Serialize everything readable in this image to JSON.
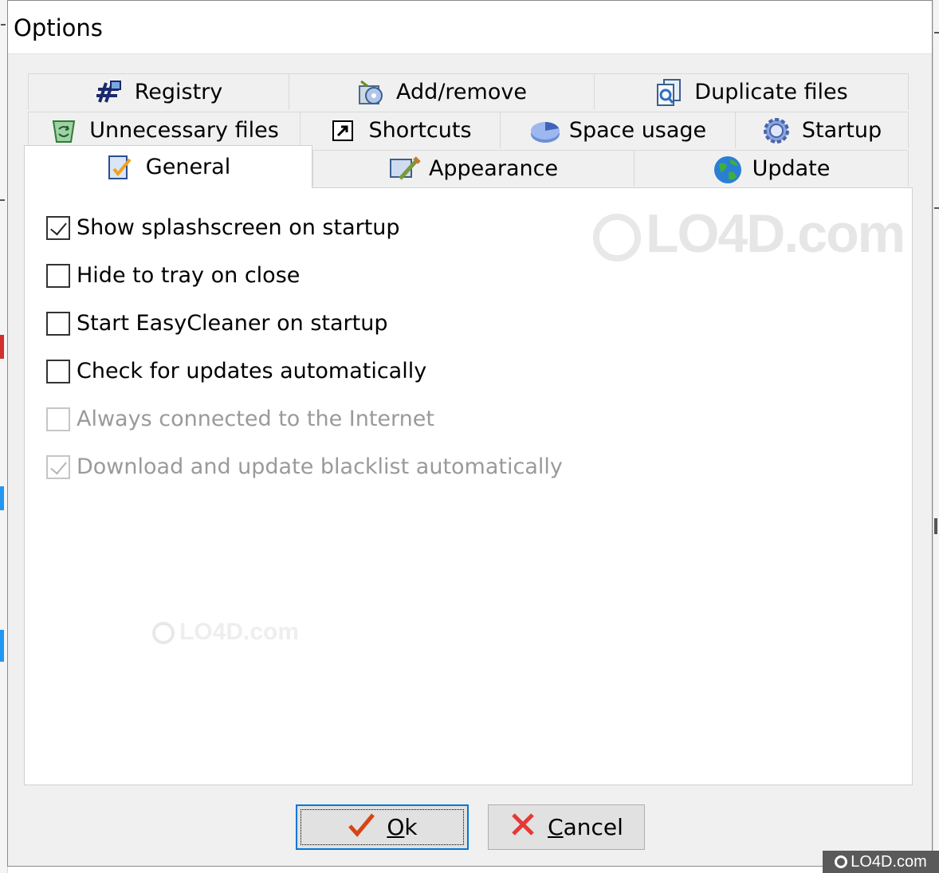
{
  "window": {
    "title": "Options"
  },
  "tabs": {
    "row1": [
      {
        "label": "Registry",
        "icon": "registry-icon"
      },
      {
        "label": "Add/remove",
        "icon": "add-remove-icon"
      },
      {
        "label": "Duplicate files",
        "icon": "duplicate-files-icon"
      }
    ],
    "row2": [
      {
        "label": "Unnecessary files",
        "icon": "recycle-bin-icon"
      },
      {
        "label": "Shortcuts",
        "icon": "shortcut-arrow-icon"
      },
      {
        "label": "Space usage",
        "icon": "pie-chart-icon"
      },
      {
        "label": "Startup",
        "icon": "gear-icon"
      }
    ],
    "row3": [
      {
        "label": "General",
        "icon": "general-settings-icon",
        "active": true
      },
      {
        "label": "Appearance",
        "icon": "appearance-icon"
      },
      {
        "label": "Update",
        "icon": "globe-icon"
      }
    ]
  },
  "options": [
    {
      "label": "Show splashscreen on startup",
      "checked": true,
      "enabled": true
    },
    {
      "label": "Hide to tray on close",
      "checked": false,
      "enabled": true
    },
    {
      "label": "Start EasyCleaner on startup",
      "checked": false,
      "enabled": true
    },
    {
      "label": "Check for updates automatically",
      "checked": false,
      "enabled": true
    },
    {
      "label": "Always connected to the Internet",
      "checked": false,
      "enabled": false
    },
    {
      "label": "Download and update blacklist automatically",
      "checked": true,
      "enabled": false
    }
  ],
  "buttons": {
    "ok": {
      "label_prefix": "",
      "label_mnemonic": "O",
      "label_rest": "k",
      "icon": "checkmark-icon"
    },
    "cancel": {
      "label_mnemonic": "C",
      "label_rest": "ancel",
      "icon": "red-x-icon"
    }
  },
  "watermark": {
    "text": "LO4D.com"
  },
  "colors": {
    "focus_border": "#0078d7",
    "check_icon": "#d84315",
    "cancel_icon": "#e53935"
  }
}
